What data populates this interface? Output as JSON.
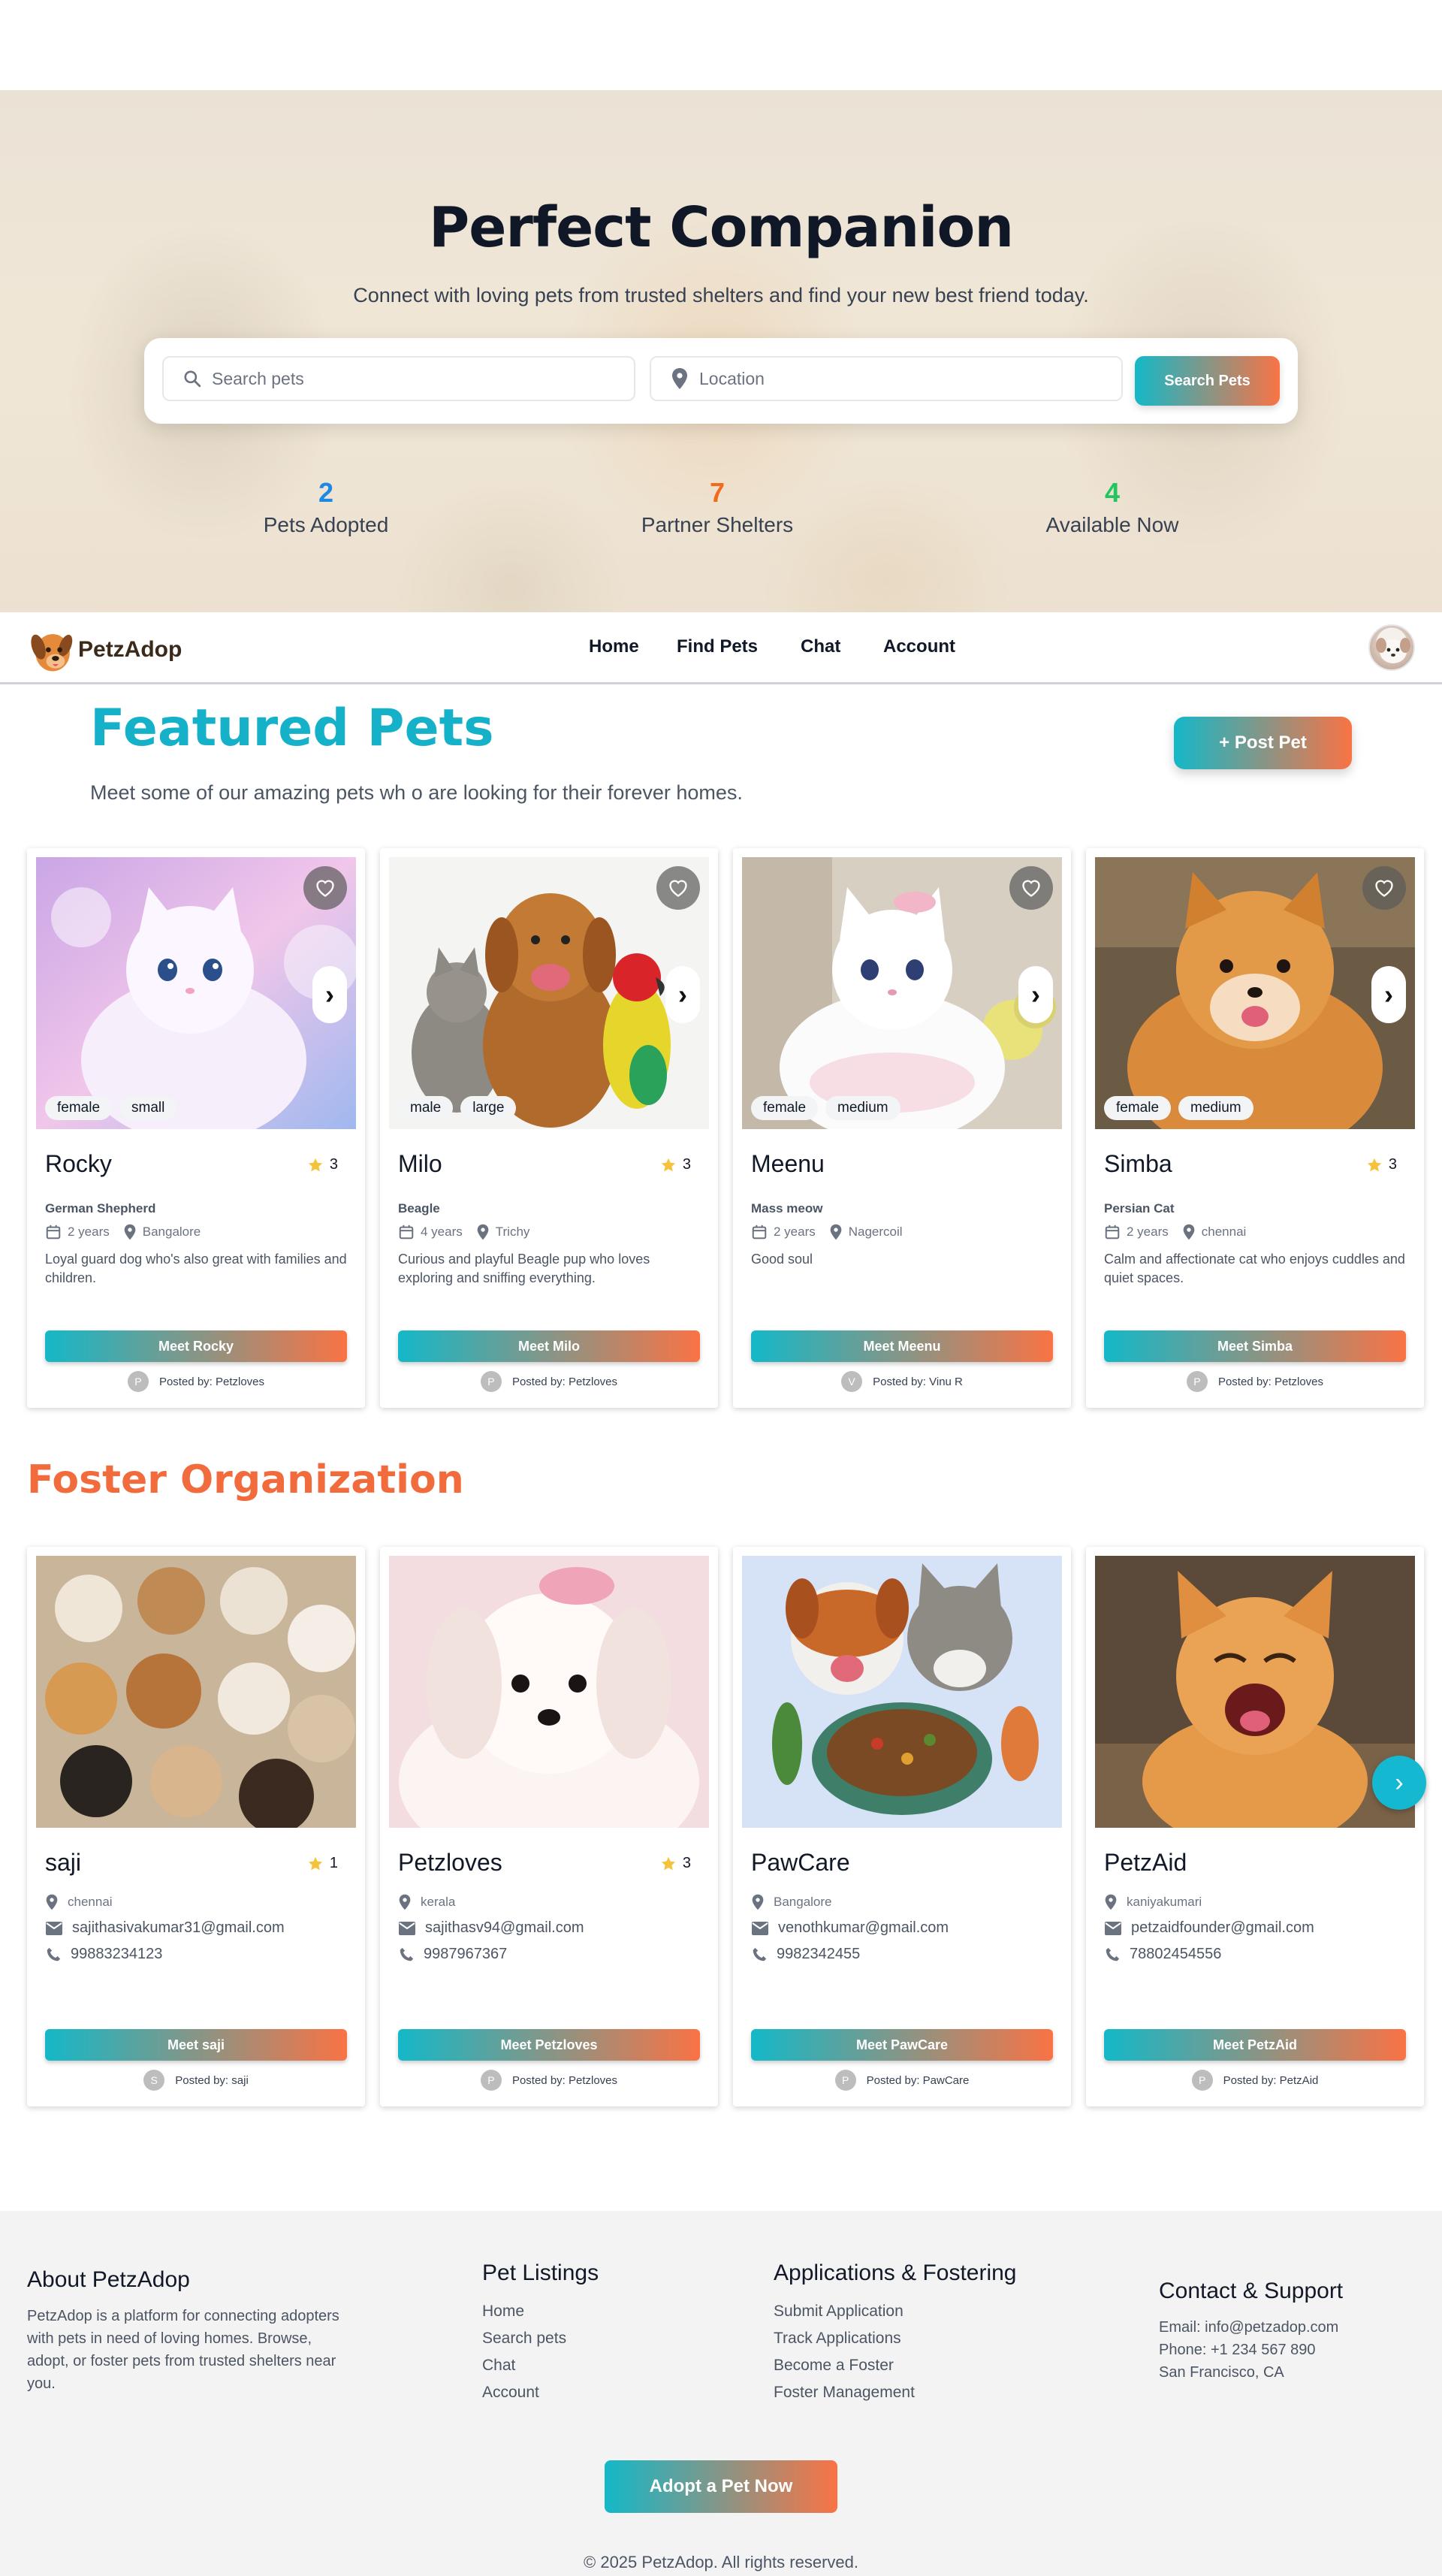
{
  "hero": {
    "title": "Perfect Companion",
    "subtitle": "Connect with loving pets from trusted shelters and find your new best friend today.",
    "search_placeholder": "Search pets",
    "location_placeholder": "Location",
    "search_button": "Search Pets",
    "stats": [
      {
        "value": "2",
        "label": "Pets Adopted",
        "color": "#1e88e5"
      },
      {
        "value": "7",
        "label": "Partner Shelters",
        "color": "#f26b1d"
      },
      {
        "value": "4",
        "label": "Available Now",
        "color": "#22c55e"
      }
    ]
  },
  "nav": {
    "brand": "PetzAdop",
    "links": [
      "Home",
      "Find Pets",
      "Chat",
      "Account"
    ]
  },
  "featured": {
    "title": "Featured Pets",
    "subtitle": "Meet some of our amazing pets wh o are looking for their forever homes.",
    "post_button": "+ Post Pet",
    "pets": [
      {
        "name": "Rocky",
        "rating": "3",
        "breed": "German Shepherd",
        "age": "2 years",
        "location": "Bangalore",
        "description": "Loyal guard dog who's also great with families and children.",
        "tags": [
          "female",
          "small"
        ],
        "button": "Meet Rocky",
        "posted_by": "Posted by: Petzloves",
        "initial": "P"
      },
      {
        "name": "Milo",
        "rating": "3",
        "breed": "Beagle",
        "age": "4 years",
        "location": "Trichy",
        "description": "Curious and playful Beagle pup who loves exploring and sniffing everything.",
        "tags": [
          "male",
          "large"
        ],
        "button": "Meet Milo",
        "posted_by": "Posted by: Petzloves",
        "initial": "P"
      },
      {
        "name": "Meenu",
        "rating": "",
        "breed": "Mass meow",
        "age": "2 years",
        "location": "Nagercoil",
        "description": "Good soul",
        "tags": [
          "female",
          "medium"
        ],
        "button": "Meet Meenu",
        "posted_by": "Posted by: Vinu R",
        "initial": "V"
      },
      {
        "name": "Simba",
        "rating": "3",
        "breed": "Persian Cat",
        "age": "2 years",
        "location": "chennai",
        "description": "Calm and affectionate cat who enjoys cuddles and quiet spaces.",
        "tags": [
          "female",
          "medium"
        ],
        "button": "Meet Simba",
        "posted_by": "Posted by: Petzloves",
        "initial": "P"
      }
    ]
  },
  "foster": {
    "title": "Foster Organization",
    "orgs": [
      {
        "name": "saji",
        "rating": "1",
        "location": "chennai",
        "email": "sajithasivakumar31@gmail.com",
        "phone": "99883234123",
        "button": "Meet saji",
        "posted_by": "Posted by: saji",
        "initial": "S"
      },
      {
        "name": "Petzloves",
        "rating": "3",
        "location": "kerala",
        "email": "sajithasv94@gmail.com",
        "phone": "9987967367",
        "button": "Meet Petzloves",
        "posted_by": "Posted by: Petzloves",
        "initial": "P"
      },
      {
        "name": "PawCare",
        "rating": "",
        "location": "Bangalore",
        "email": "venothkumar@gmail.com",
        "phone": "9982342455",
        "button": "Meet PawCare",
        "posted_by": "Posted by: PawCare",
        "initial": "P"
      },
      {
        "name": "PetzAid",
        "rating": "",
        "location": "kaniyakumari",
        "email": "petzaidfounder@gmail.com",
        "phone": "78802454556",
        "button": "Meet PetzAid",
        "posted_by": "Posted by: PetzAid",
        "initial": "P"
      }
    ]
  },
  "footer": {
    "about_title": "About PetzAdop",
    "about_text": "PetzAdop is a platform for connecting adopters with pets in need of loving homes. Browse, adopt, or foster pets from trusted shelters near you.",
    "listings_title": "Pet Listings",
    "listings": [
      "Home",
      "Search pets",
      "Chat",
      "Account"
    ],
    "apps_title": "Applications & Fostering",
    "apps": [
      "Submit Application",
      "Track Applications",
      "Become a Foster",
      "Foster Management"
    ],
    "contact_title": "Contact & Support",
    "contact": [
      "Email: info@petzadop.com",
      "Phone: +1 234 567 890",
      "San Francisco, CA"
    ],
    "cta": "Adopt a Pet Now",
    "copyright": "© 2025 PetzAdop. All rights reserved."
  }
}
